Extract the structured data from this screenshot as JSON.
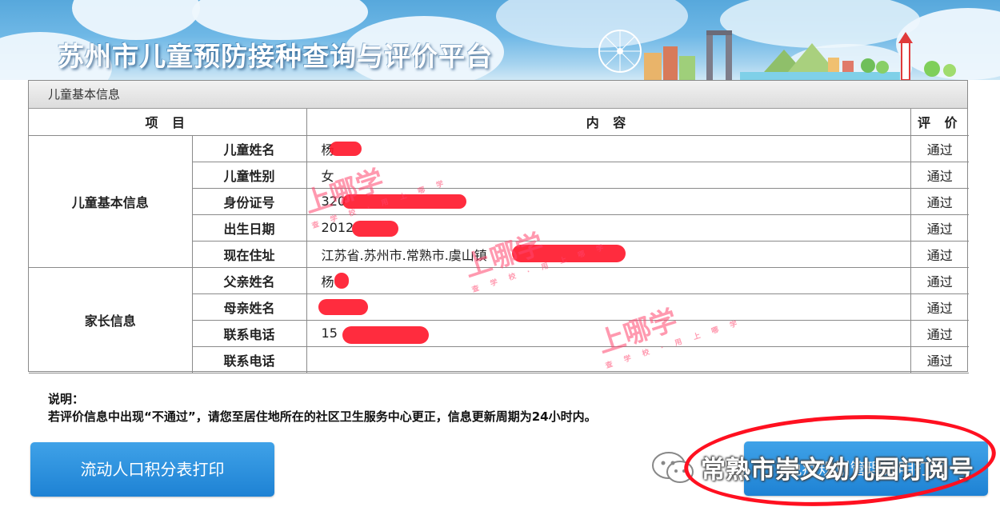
{
  "banner": {
    "title": "苏州市儿童预防接种查询与评价平台"
  },
  "panel": {
    "header": "儿童基本信息",
    "columns": {
      "item": "项 目",
      "content": "内 容",
      "evaluation": "评 价"
    },
    "groups": [
      {
        "label": "儿童基本信息",
        "rows": [
          {
            "field": "儿童姓名",
            "value": "杨",
            "eval": "通过"
          },
          {
            "field": "儿童性别",
            "value": "女",
            "eval": "通过"
          },
          {
            "field": "身份证号",
            "value": "320",
            "eval": "通过"
          },
          {
            "field": "出生日期",
            "value": "2012",
            "eval": "通过"
          },
          {
            "field": "现在住址",
            "value": "江苏省.苏州市.常熟市.虞山镇",
            "eval": "通过"
          }
        ]
      },
      {
        "label": "家长信息",
        "rows": [
          {
            "field": "父亲姓名",
            "value": "杨",
            "eval": "通过"
          },
          {
            "field": "母亲姓名",
            "value": "",
            "eval": "通过"
          },
          {
            "field": "联系电话",
            "value": "15",
            "eval": "通过"
          },
          {
            "field": "联系电话",
            "value": "",
            "eval": "通过"
          }
        ]
      }
    ]
  },
  "watermark": {
    "big": "上哪学",
    "small": "查 学 校 · 用 上 哪 学"
  },
  "notes": {
    "title": "说明：",
    "text": "若评价信息中出现“不通过”，请您至居住地所在的社区卫生服务中心更正，信息更新周期为24小时内。"
  },
  "buttons": {
    "left": "流动人口积分表打印",
    "right": "免疫规划管理证明打印"
  },
  "overlay": {
    "text": "常熟市崇文幼儿园订阅号"
  },
  "colors": {
    "banner": "#6fb8e6",
    "button": "#1e82d4",
    "redact": "#ff1a2e"
  }
}
